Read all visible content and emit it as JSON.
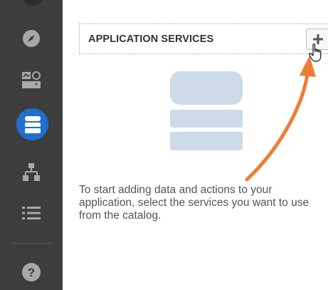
{
  "sidebar": {
    "items": [
      {
        "name": "explore",
        "icon": "compass-icon"
      },
      {
        "name": "ui-designer",
        "icon": "ui-widgets-icon"
      },
      {
        "name": "data-services",
        "icon": "database-icon",
        "active": true
      },
      {
        "name": "structure",
        "icon": "hierarchy-icon"
      },
      {
        "name": "list",
        "icon": "list-icon"
      },
      {
        "name": "help",
        "icon": "help-icon"
      }
    ],
    "active_color": "#1e6fd0",
    "background": "#3d3d3d"
  },
  "services": {
    "title": "APPLICATION SERVICES",
    "add_icon": "plus-icon",
    "empty_message": "To start adding data and actions to your application, select the services you want to use from the catalog."
  },
  "colors": {
    "arrow": "#ee7d36",
    "illustration": "#cddbe8"
  }
}
